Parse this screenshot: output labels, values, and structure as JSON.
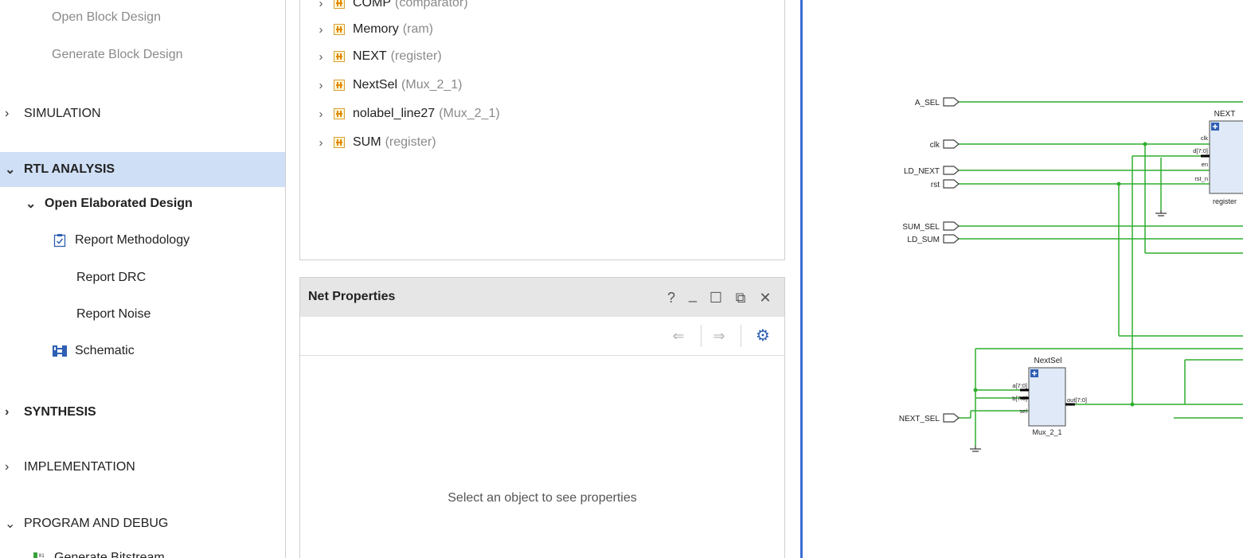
{
  "flow_navigator": {
    "top_items": [
      {
        "label": "Open Block Design"
      },
      {
        "label": "Generate Block Design"
      }
    ],
    "simulation": {
      "label": "SIMULATION"
    },
    "rtl_analysis": {
      "label": "RTL ANALYSIS",
      "open_elaborated": "Open Elaborated Design",
      "children": [
        {
          "label": "Report Methodology",
          "icon": "clipboard-check-icon"
        },
        {
          "label": "Report DRC"
        },
        {
          "label": "Report Noise"
        },
        {
          "label": "Schematic",
          "icon": "schematic-icon"
        }
      ]
    },
    "synthesis": {
      "label": "SYNTHESIS"
    },
    "implementation": {
      "label": "IMPLEMENTATION"
    },
    "program_debug": {
      "label": "PROGRAM AND DEBUG",
      "children": [
        {
          "label": "Generate Bitstream",
          "icon": "bitstream-icon"
        }
      ]
    }
  },
  "hierarchy": {
    "rows": [
      {
        "name": "COMP",
        "type": "(comparator)"
      },
      {
        "name": "Memory",
        "type": "(ram)"
      },
      {
        "name": "NEXT",
        "type": "(register)"
      },
      {
        "name": "NextSel",
        "type": "(Mux_2_1)"
      },
      {
        "name": "nolabel_line27",
        "type": "(Mux_2_1)"
      },
      {
        "name": "SUM",
        "type": "(register)"
      }
    ]
  },
  "net_properties": {
    "title": "Net Properties",
    "buttons": {
      "help": "?",
      "minimize": "_",
      "maximize": "☐",
      "float": "⧉",
      "close": "✕"
    },
    "toolbar": {
      "back": "⇐",
      "forward": "⇒",
      "settings": "⚙"
    },
    "empty_message": "Select an object to see properties"
  },
  "schematic": {
    "ports": [
      {
        "label": "A_SEL"
      },
      {
        "label": "clk"
      },
      {
        "label": "LD_NEXT"
      },
      {
        "label": "rst"
      },
      {
        "label": "SUM_SEL"
      },
      {
        "label": "LD_SUM"
      },
      {
        "label": "NEXT_SEL"
      }
    ],
    "next_block": {
      "name": "NEXT",
      "type": "register",
      "pins": [
        "clk",
        "d[7:0]",
        "en",
        "rst_n"
      ]
    },
    "nextsel_block": {
      "name": "NextSel",
      "type": "Mux_2_1",
      "pins": [
        "a[7:0]",
        "b[7:0]",
        "sel"
      ],
      "out_pin": "out[7:0]"
    },
    "colors": {
      "wire": "#2fae2f",
      "block_fill": "#dfe9f7",
      "block_stroke": "#4a4a4a",
      "selection": "#cfdff5",
      "divider": "#3b6dd3"
    }
  }
}
